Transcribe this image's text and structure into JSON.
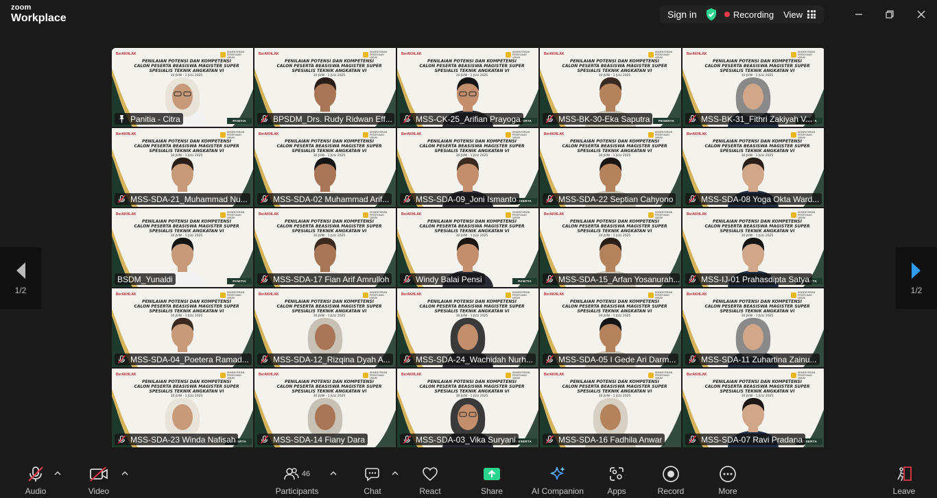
{
  "app": {
    "brand_top": "zoom",
    "brand_bottom": "Workplace"
  },
  "topbar": {
    "sign_in": "Sign in",
    "recording": "Recording",
    "view": "View"
  },
  "colors": {
    "active_speaker": "#2bd48f",
    "recording_dot": "#e8394a",
    "shield": "#2bd48f",
    "share": "#2bd48f"
  },
  "tile_banner": {
    "left_logo": "BerAKHLAK",
    "right_logo": "KEMENTERIAN PEKERJAAN UMUM",
    "line1": "PENILAIAN POTENSI DAN KOMPETENSI",
    "line2": "CALON PESERTA BEASISWA MAGISTER SUPER",
    "line3": "SPESIALIS TEKNIK ANGKATAN VI",
    "date": "30 JUNI - 1 JULI 2025"
  },
  "participants": [
    {
      "name": "Panitia - Citra",
      "muted": false,
      "pinned": true,
      "role": "PANITIA",
      "active": true
    },
    {
      "name": "BPSDM_Drs. Rudy Ridwan Eff...",
      "muted": true,
      "role": ""
    },
    {
      "name": "MSS-CK-25_Arifian Prayoga",
      "muted": true,
      "role": "PESERTA"
    },
    {
      "name": "MSS-BK-30-Eka Saputra",
      "muted": true,
      "role": "PESERTA"
    },
    {
      "name": "MSS-BK-31_Fithri Zakiyah V...",
      "muted": true,
      "role": "PESERTA"
    },
    {
      "name": "MSS-SDA-21_Muhammad Nu...",
      "muted": true,
      "role": ""
    },
    {
      "name": "MSS-SDA-02 Muhammad Arif...",
      "muted": true,
      "role": ""
    },
    {
      "name": "MSS-SDA-09_Joni Ismanto",
      "muted": true,
      "role": "PESERTA"
    },
    {
      "name": "MSS-SDA-22 Septian Cahyono",
      "muted": true,
      "role": ""
    },
    {
      "name": "MSS-SDA-08 Yoga Okta Ward...",
      "muted": true,
      "role": ""
    },
    {
      "name": "BSDM_Yunaldi",
      "muted": false,
      "role": "PANITIA"
    },
    {
      "name": "MSS-SDA-17 Fian Arif Amrulloh",
      "muted": true,
      "role": ""
    },
    {
      "name": "Windy Balai Pensi",
      "muted": true,
      "role": "PANITIA"
    },
    {
      "name": "MSS-SDA-15_Arfan Yosanurah...",
      "muted": true,
      "role": ""
    },
    {
      "name": "MSS-IJ-01 Prahasdipta Satya",
      "muted": true,
      "role": "PESERTA"
    },
    {
      "name": "MSS-SDA-04_Poetera Ramad...",
      "muted": true,
      "role": ""
    },
    {
      "name": "MSS-SDA-12_Rizqina Dyah A...",
      "muted": true,
      "role": ""
    },
    {
      "name": "MSS-SDA-24_Wachidah Nurh...",
      "muted": true,
      "role": ""
    },
    {
      "name": "MSS-SDA-05 I Gede Ari Darm...",
      "muted": true,
      "role": ""
    },
    {
      "name": "MSS-SDA-11 Zuhartina Zainu...",
      "muted": true,
      "role": ""
    },
    {
      "name": "MSS-SDA-23 Winda Nafisah",
      "muted": true,
      "role": "PESERTA"
    },
    {
      "name": "MSS-SDA-14 Fiany Dara",
      "muted": true,
      "role": ""
    },
    {
      "name": "MSS-SDA-03_Vika Suryani",
      "muted": true,
      "role": "PESERTA"
    },
    {
      "name": "MSS-SDA-16 Fadhila Anwar",
      "muted": true,
      "role": ""
    },
    {
      "name": "MSS-SDA-07 Ravi Pradana",
      "muted": true,
      "role": "PESERTA"
    }
  ],
  "pager": {
    "left": "1/2",
    "right": "1/2"
  },
  "toolbar": {
    "audio": "Audio",
    "video": "Video",
    "participants": "Participants",
    "participants_count": "46",
    "chat": "Chat",
    "react": "React",
    "share": "Share",
    "ai_companion": "AI Companion",
    "apps": "Apps",
    "record": "Record",
    "more": "More",
    "leave": "Leave"
  }
}
